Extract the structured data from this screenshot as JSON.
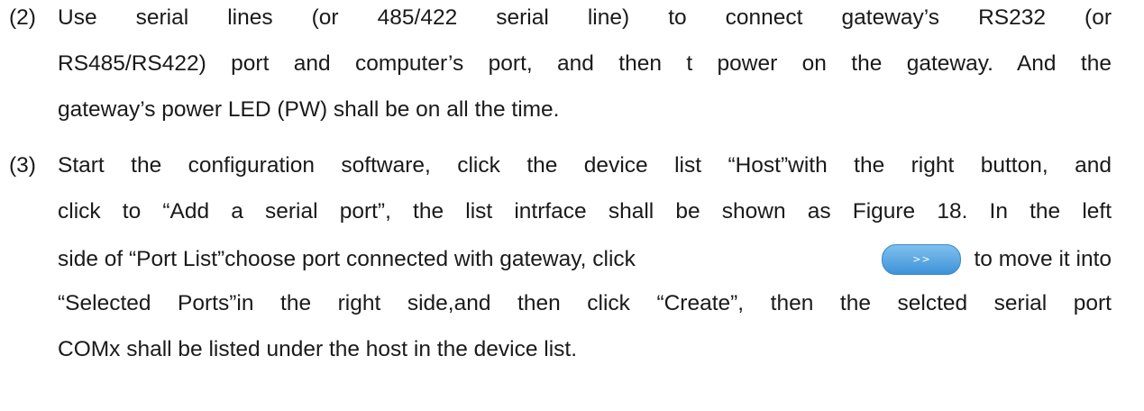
{
  "items": [
    {
      "number": "(2)",
      "lines": [
        "Use serial lines (or 485/422 serial line) to connect gateway’s RS232 (or",
        "RS485/RS422) port and computer’s port, and then t power on the gateway. And the",
        "gateway’s power LED (PW) shall be on all the time."
      ]
    },
    {
      "number": "(3)",
      "lines": [
        "Start the configuration software, click the device list “Host”with the right button, and",
        "click to “Add a serial port”, the list intrface shall be shown as Figure 18. In the left",
        "side of “Port List”choose port connected with gateway, click",
        "to move it into",
        "“Selected Ports”in the right side,and then click “Create”, then the selcted serial port",
        "COMx shall be listed under the host in the device list."
      ],
      "inline_button": {
        "label": ">>",
        "color": "#5aa9e3"
      }
    }
  ]
}
